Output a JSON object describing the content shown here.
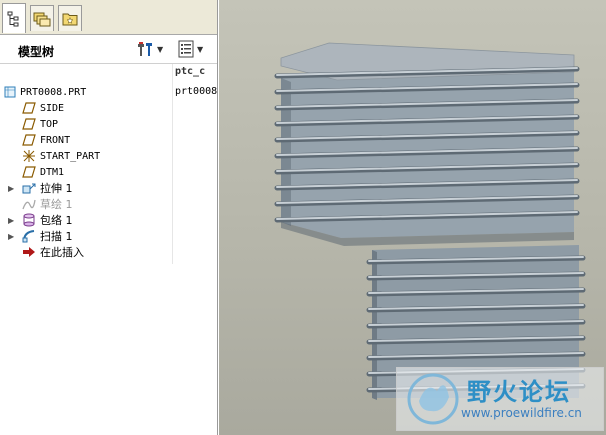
{
  "tabs": [
    {
      "icon": "model-tree-tab-icon",
      "active": true
    },
    {
      "icon": "layers-tab-icon",
      "active": false
    },
    {
      "icon": "favorites-tab-icon",
      "active": false
    }
  ],
  "panel": {
    "title": "模型树",
    "column_header": "ptc_c",
    "root_value": "prt0008"
  },
  "tree": {
    "root": "PRT0008.PRT",
    "items": [
      {
        "label": "SIDE",
        "icon": "datum-plane-icon"
      },
      {
        "label": "TOP",
        "icon": "datum-plane-icon"
      },
      {
        "label": "FRONT",
        "icon": "datum-plane-icon"
      },
      {
        "label": "START_PART",
        "icon": "coordinate-system-icon"
      },
      {
        "label": "DTM1",
        "icon": "datum-plane-icon"
      },
      {
        "label": "拉伸 1",
        "icon": "extrude-icon"
      },
      {
        "label": "草绘 1",
        "icon": "sketch-icon"
      },
      {
        "label": "包络 1",
        "icon": "wrap-icon"
      },
      {
        "label": "扫描 1",
        "icon": "sweep-icon"
      },
      {
        "label": "在此插入",
        "icon": "insert-here-arrow-icon"
      }
    ]
  },
  "watermark": {
    "title": "野火论坛",
    "url": "www.proewildfire.cn"
  },
  "colors": {
    "viewport_bg": "#b8b8ac",
    "model_face": "#8d9aa4",
    "model_top": "#aab3bb",
    "rib": "#c4ccd3"
  }
}
